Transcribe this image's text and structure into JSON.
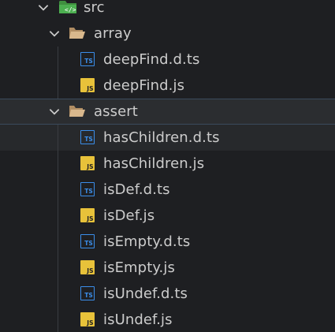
{
  "tree": {
    "root": {
      "label": "src",
      "icon": "src-folder-icon"
    },
    "folders": [
      {
        "label": "array",
        "icon": "folder-open-icon",
        "files": [
          {
            "label": "deepFind.d.ts",
            "type": "TS",
            "icon": "typescript-file-icon"
          },
          {
            "label": "deepFind.js",
            "type": "JS",
            "icon": "javascript-file-icon"
          }
        ]
      },
      {
        "label": "assert",
        "icon": "folder-open-icon",
        "files": [
          {
            "label": "hasChildren.d.ts",
            "type": "TS",
            "icon": "typescript-file-icon"
          },
          {
            "label": "hasChildren.js",
            "type": "JS",
            "icon": "javascript-file-icon"
          },
          {
            "label": "isDef.d.ts",
            "type": "TS",
            "icon": "typescript-file-icon"
          },
          {
            "label": "isDef.js",
            "type": "JS",
            "icon": "javascript-file-icon"
          },
          {
            "label": "isEmpty.d.ts",
            "type": "TS",
            "icon": "typescript-file-icon"
          },
          {
            "label": "isEmpty.js",
            "type": "JS",
            "icon": "javascript-file-icon"
          },
          {
            "label": "isUndef.d.ts",
            "type": "TS",
            "icon": "typescript-file-icon"
          },
          {
            "label": "isUndef.js",
            "type": "JS",
            "icon": "javascript-file-icon"
          }
        ]
      }
    ]
  },
  "colors": {
    "background": "#1e1f22",
    "text": "#cccccc",
    "ts_blue": "#3b8eea",
    "js_yellow": "#e8c23a",
    "folder_tan": "#c4a47c",
    "src_green": "#4caf50"
  }
}
